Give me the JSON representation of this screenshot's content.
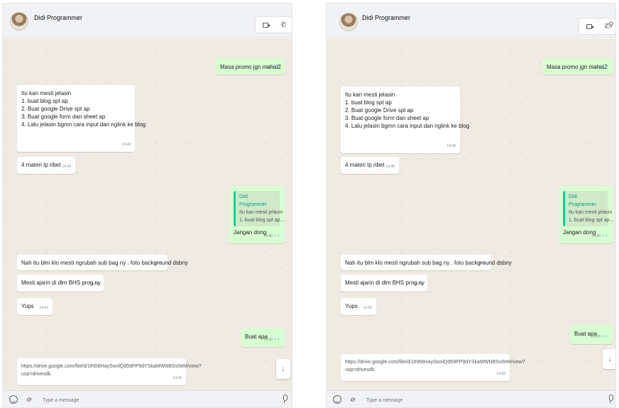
{
  "contact": {
    "name": "Didi Programmer"
  },
  "header_icons": [
    "video-call-icon",
    "voice-call-icon",
    "search-icon"
  ],
  "messages": [
    {
      "dir": "out",
      "lines": [
        "Masa promo jgn mahal2"
      ],
      "time": "14:39",
      "ticks": "✓✓"
    },
    {
      "dir": "in",
      "lines": [
        "Itu kan mesti jelasin",
        "1. buat blog spt ap",
        "2. Buat google Drive spt ap",
        "3. Buat google form dan sheet ap",
        "4. Lalu jelasin bgmn cara input dan nglink ke blog"
      ],
      "time": "14:40"
    },
    {
      "dir": "in",
      "lines": [
        "4 materi tp ribet"
      ],
      "time": "14:40"
    },
    {
      "dir": "out",
      "quote": {
        "author": "Didi Programmer",
        "lines": [
          "Itu kan mesti jelasin",
          "1. buat blog spt ap..."
        ]
      },
      "lines": [
        "Jangan dong"
      ],
      "time": "14:40",
      "ticks": "✓✓"
    },
    {
      "dir": "in",
      "lines": [
        "Nah itu blm klo mesti ngrubah sub bag ny . foto background dsbny"
      ],
      "time": "14:41"
    },
    {
      "dir": "in",
      "lines": [
        "Mesti ajarin di dlm BHS prog ny"
      ],
      "time": "14:41"
    },
    {
      "dir": "in",
      "lines": [
        "Yups"
      ],
      "time": "14:42"
    },
    {
      "dir": "out",
      "lines": [
        "Buat apa"
      ],
      "time": "14:43",
      "ticks": "✓✓"
    },
    {
      "dir": "in",
      "link": true,
      "lines": [
        "https://drive.google.com/file/d/1tN56HaySwxlQd59PP9dYSkaMWNBSv0eM/view?",
        "usp=drivesdk"
      ],
      "time": "14:43"
    }
  ],
  "scroll_down_icon": "↓",
  "composer": {
    "placeholder": "Type a message",
    "attach_icon": "paperclip-icon",
    "emoji_icon": "emoji-icon",
    "mic_icon": "mic-icon"
  },
  "colors": {
    "outgoing_bubble": "#d9fdd3",
    "incoming_bubble": "#ffffff",
    "chat_background": "#efeae2",
    "read_ticks": "#53bdeb",
    "quote_accent": "#06cf9c"
  }
}
